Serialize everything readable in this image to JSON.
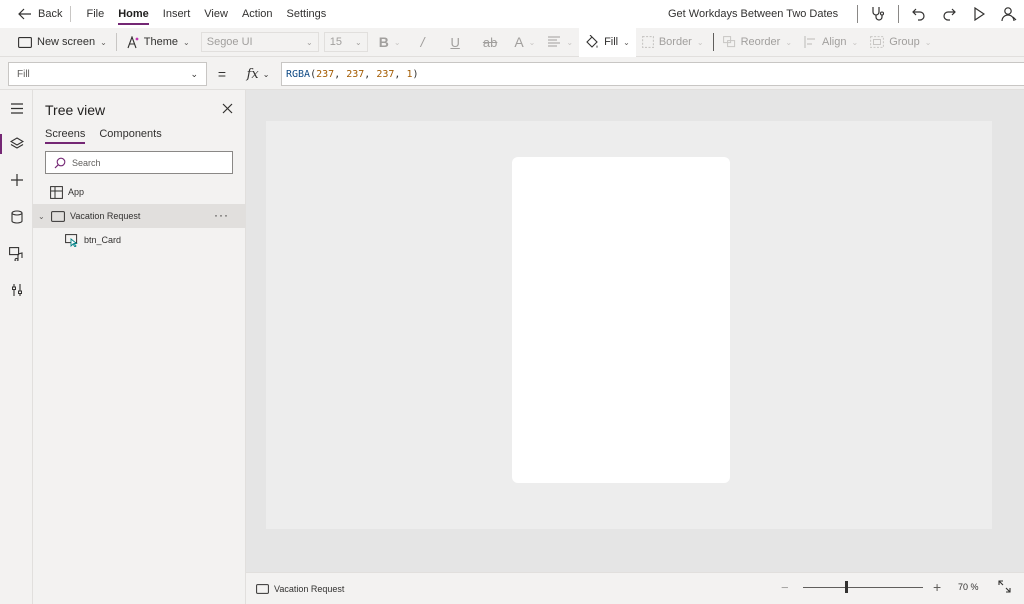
{
  "menu": {
    "back_label": "Back",
    "items": [
      "File",
      "Home",
      "Insert",
      "View",
      "Action",
      "Settings"
    ],
    "active_item": "Home",
    "app_title": "Get Workdays Between Two Dates"
  },
  "ribbon": {
    "new_screen": "New screen",
    "theme": "Theme",
    "font_family": "Segoe UI",
    "font_size": "15",
    "fill": "Fill",
    "border": "Border",
    "reorder": "Reorder",
    "align": "Align",
    "group": "Group"
  },
  "formula_bar": {
    "property": "Fill",
    "equals": "=",
    "fx_label": "fx",
    "formula_fn": "RGBA",
    "formula_args": [
      "237",
      "237",
      "237",
      "1"
    ]
  },
  "tree_view": {
    "title": "Tree view",
    "tabs": [
      "Screens",
      "Components"
    ],
    "active_tab": "Screens",
    "search_placeholder": "Search",
    "items": {
      "app": "App",
      "screen": "Vacation Request",
      "control": "btn_Card"
    },
    "more_label": "···"
  },
  "status_bar": {
    "screen_name": "Vacation Request",
    "zoom_minus": "−",
    "zoom_plus": "+",
    "zoom_value": "70  %",
    "zoom_level": 0.35
  },
  "colors": {
    "accent": "#742774",
    "screen_fill": "#ededed",
    "card_fill": "#ffffff"
  }
}
